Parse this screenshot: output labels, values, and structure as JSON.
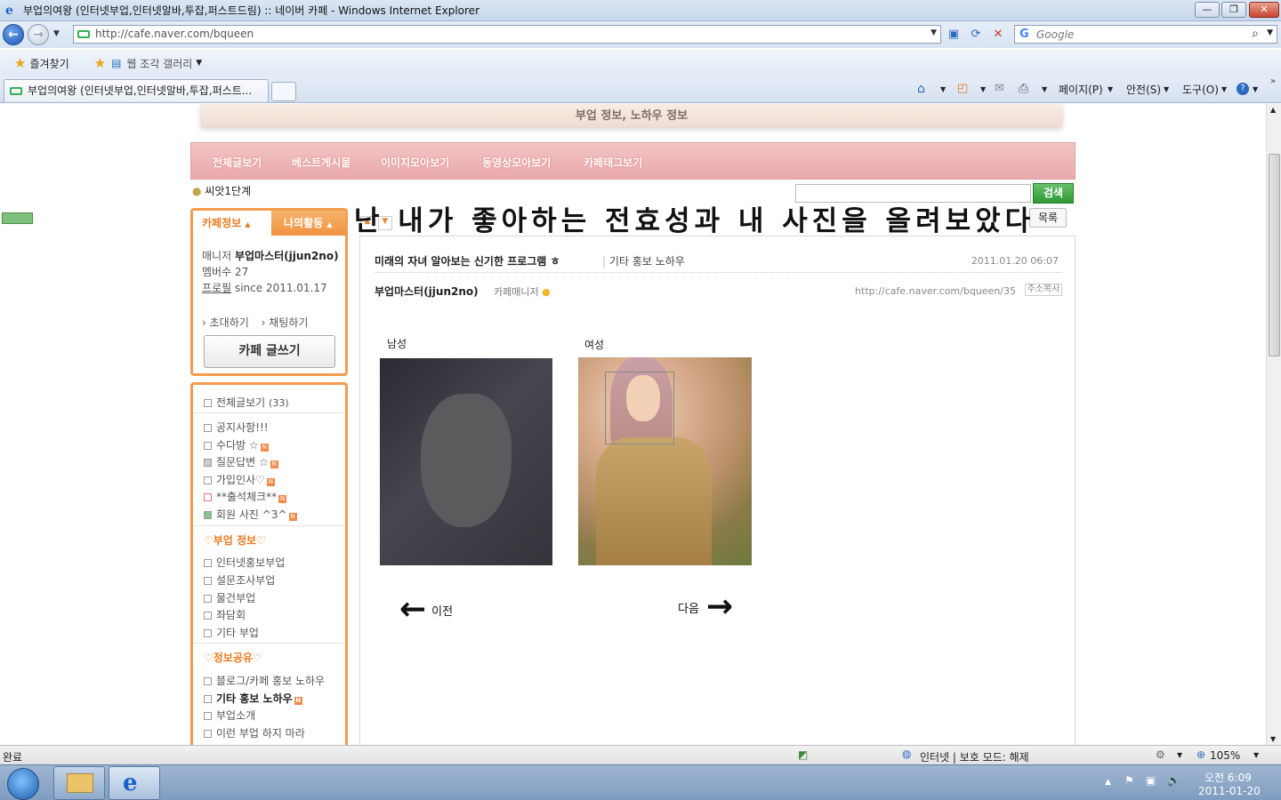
{
  "window": {
    "title": "부업의여왕 (인터넷부업,인터넷알바,투잡,퍼스트드림) :: 네이버 카페 - Windows Internet Explorer",
    "controls": [
      "—",
      "❐",
      "✕"
    ]
  },
  "nav": {
    "url": "http://cafe.naver.com/bqueen",
    "search_placeholder": "Google",
    "search_logo": "G"
  },
  "favorites": {
    "favorites_label": "즐겨찾기",
    "gallery_label": "웹 조각 갤러리"
  },
  "tabbar": {
    "tab_title": "부업의여왕 (인터넷부업,인터넷알바,투잡,퍼스트...",
    "commands": [
      "페이지(P)",
      "안전(S)",
      "도구(O)"
    ]
  },
  "page": {
    "banner": "부업 정보, 노하우 정보",
    "menu": [
      "전체글보기",
      "베스트게시물",
      "이미지모아보기",
      "동영상모아보기",
      "카페태그보기"
    ],
    "level": "씨앗1단계",
    "search_button": "검색",
    "overlay_caption": "난 내가 좋아하는 전효성과 내 사진을 올려보았다",
    "list_button": "목록",
    "cafe_info": {
      "tab1": "카페정보",
      "tab2": "나의활동",
      "manager_label": "매니저",
      "manager_name": "부업마스터(jjun2no)",
      "members": "멤버수 27",
      "profile_label": "프로필",
      "since": "since 2011.01.17",
      "invite": "초대하기",
      "chat": "채팅하기",
      "write_button": "카페 글쓰기"
    },
    "sidebar": {
      "all": "전체글보기",
      "all_count": "(33)",
      "group1": [
        "공지사항!!!",
        "수다방 ☆",
        "질문답변 ☆",
        "가입인사♡",
        "**출석체크**",
        "회원 사진 ^3^"
      ],
      "section2": "♡부업 정보♡",
      "group2": [
        "인터넷홍보부업",
        "설문조사부업",
        "물건부업",
        "좌담회",
        "기타 부업"
      ],
      "section3": "♡정보공유♡",
      "group3": [
        "블로그/카페 홍보 노하우",
        "기타 홍보 노하우",
        "부업소개",
        "이런 부업 하지 마라"
      ],
      "new_badge": "N"
    },
    "article": {
      "title": "미래의 자녀 알아보는 신기한 프로그램 ㅎ",
      "category": "기타 홍보 노하우",
      "date": "2011.01.20 06:07",
      "author": "부업마스터(jjun2no)",
      "role": "카페매니저",
      "url": "http://cafe.naver.com/bqueen/35",
      "copy_button": "주소복사",
      "male_label": "남성",
      "female_label": "여성",
      "prev": "이전",
      "next": "다음",
      "tilde": "~"
    }
  },
  "status": {
    "text": "완료",
    "zone": "인터넷 | 보호 모드: 해제",
    "zoom": "105%"
  },
  "taskbar": {
    "time": "오전 6:09",
    "date": "2011-01-20"
  }
}
